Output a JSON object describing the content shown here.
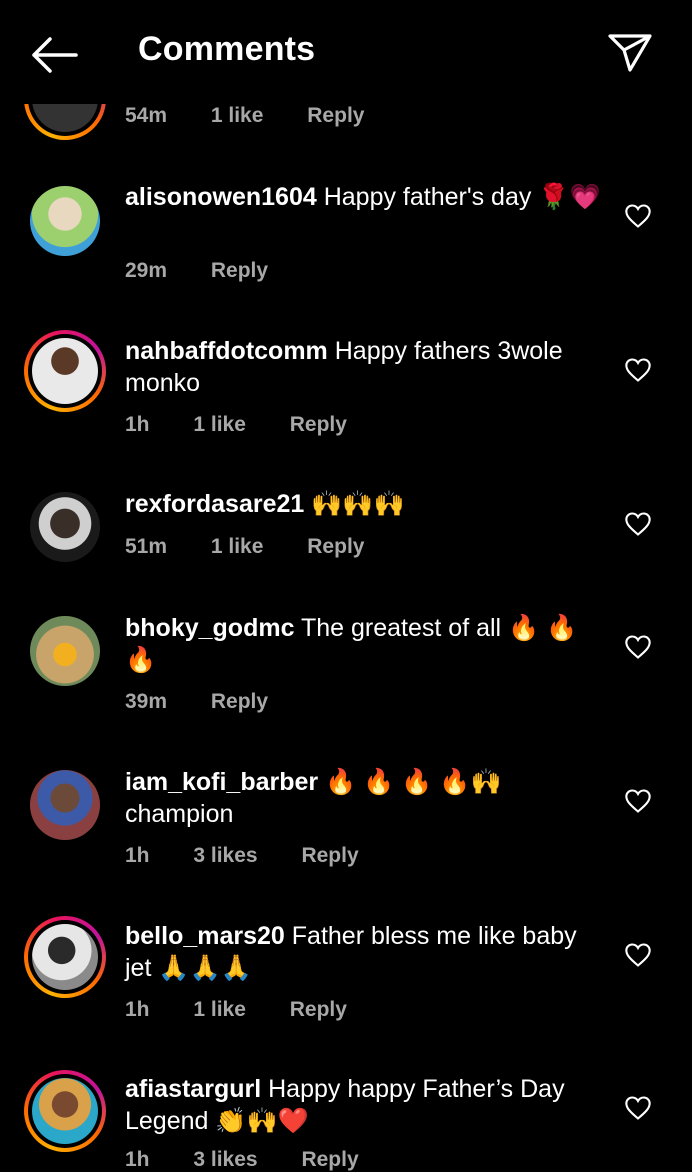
{
  "header": {
    "title": "Comments"
  },
  "partial_top": {
    "time": "54m",
    "likes": "1 like",
    "reply": "Reply"
  },
  "comments": [
    {
      "username": "alisonowen1604",
      "text": "Happy father's day",
      "emoji": "🌹💗",
      "time": "29m",
      "likes": "",
      "reply": "Reply",
      "avatar": "gradient-ring-none"
    },
    {
      "username": "nahbaffdotcomm",
      "text": "Happy fathers 3wole monko",
      "emoji": "",
      "time": "1h",
      "likes": "1 like",
      "reply": "Reply"
    },
    {
      "username": "rexfordasare21",
      "text": "",
      "emoji": "🙌🙌🙌",
      "time": "51m",
      "likes": "1 like",
      "reply": "Reply"
    },
    {
      "username": "bhoky_godmc",
      "text": "The greatest of all",
      "emoji": "🔥 🔥 🔥",
      "time": "39m",
      "likes": "",
      "reply": "Reply"
    },
    {
      "username": "iam_kofi_barber",
      "text": "champion",
      "emoji": "🔥 🔥 🔥 🔥🙌",
      "time": "1h",
      "likes": "3 likes",
      "reply": "Reply"
    },
    {
      "username": "bello_mars20",
      "text": "Father bless me like baby jet",
      "emoji": "🙏🙏🙏",
      "time": "1h",
      "likes": "1 like",
      "reply": "Reply"
    },
    {
      "username": "afiastargurl",
      "text": "Happy happy Father’s Day Legend",
      "emoji": "👏🙌❤️",
      "time": "1h",
      "likes": "3 likes",
      "reply": "Reply"
    }
  ],
  "colors": {
    "background": "#000000",
    "text": "#ffffff",
    "meta": "#a8a8a8",
    "story_ring": "#e8145c"
  },
  "icons": [
    "back-arrow-icon",
    "send-icon",
    "heart-icon"
  ]
}
